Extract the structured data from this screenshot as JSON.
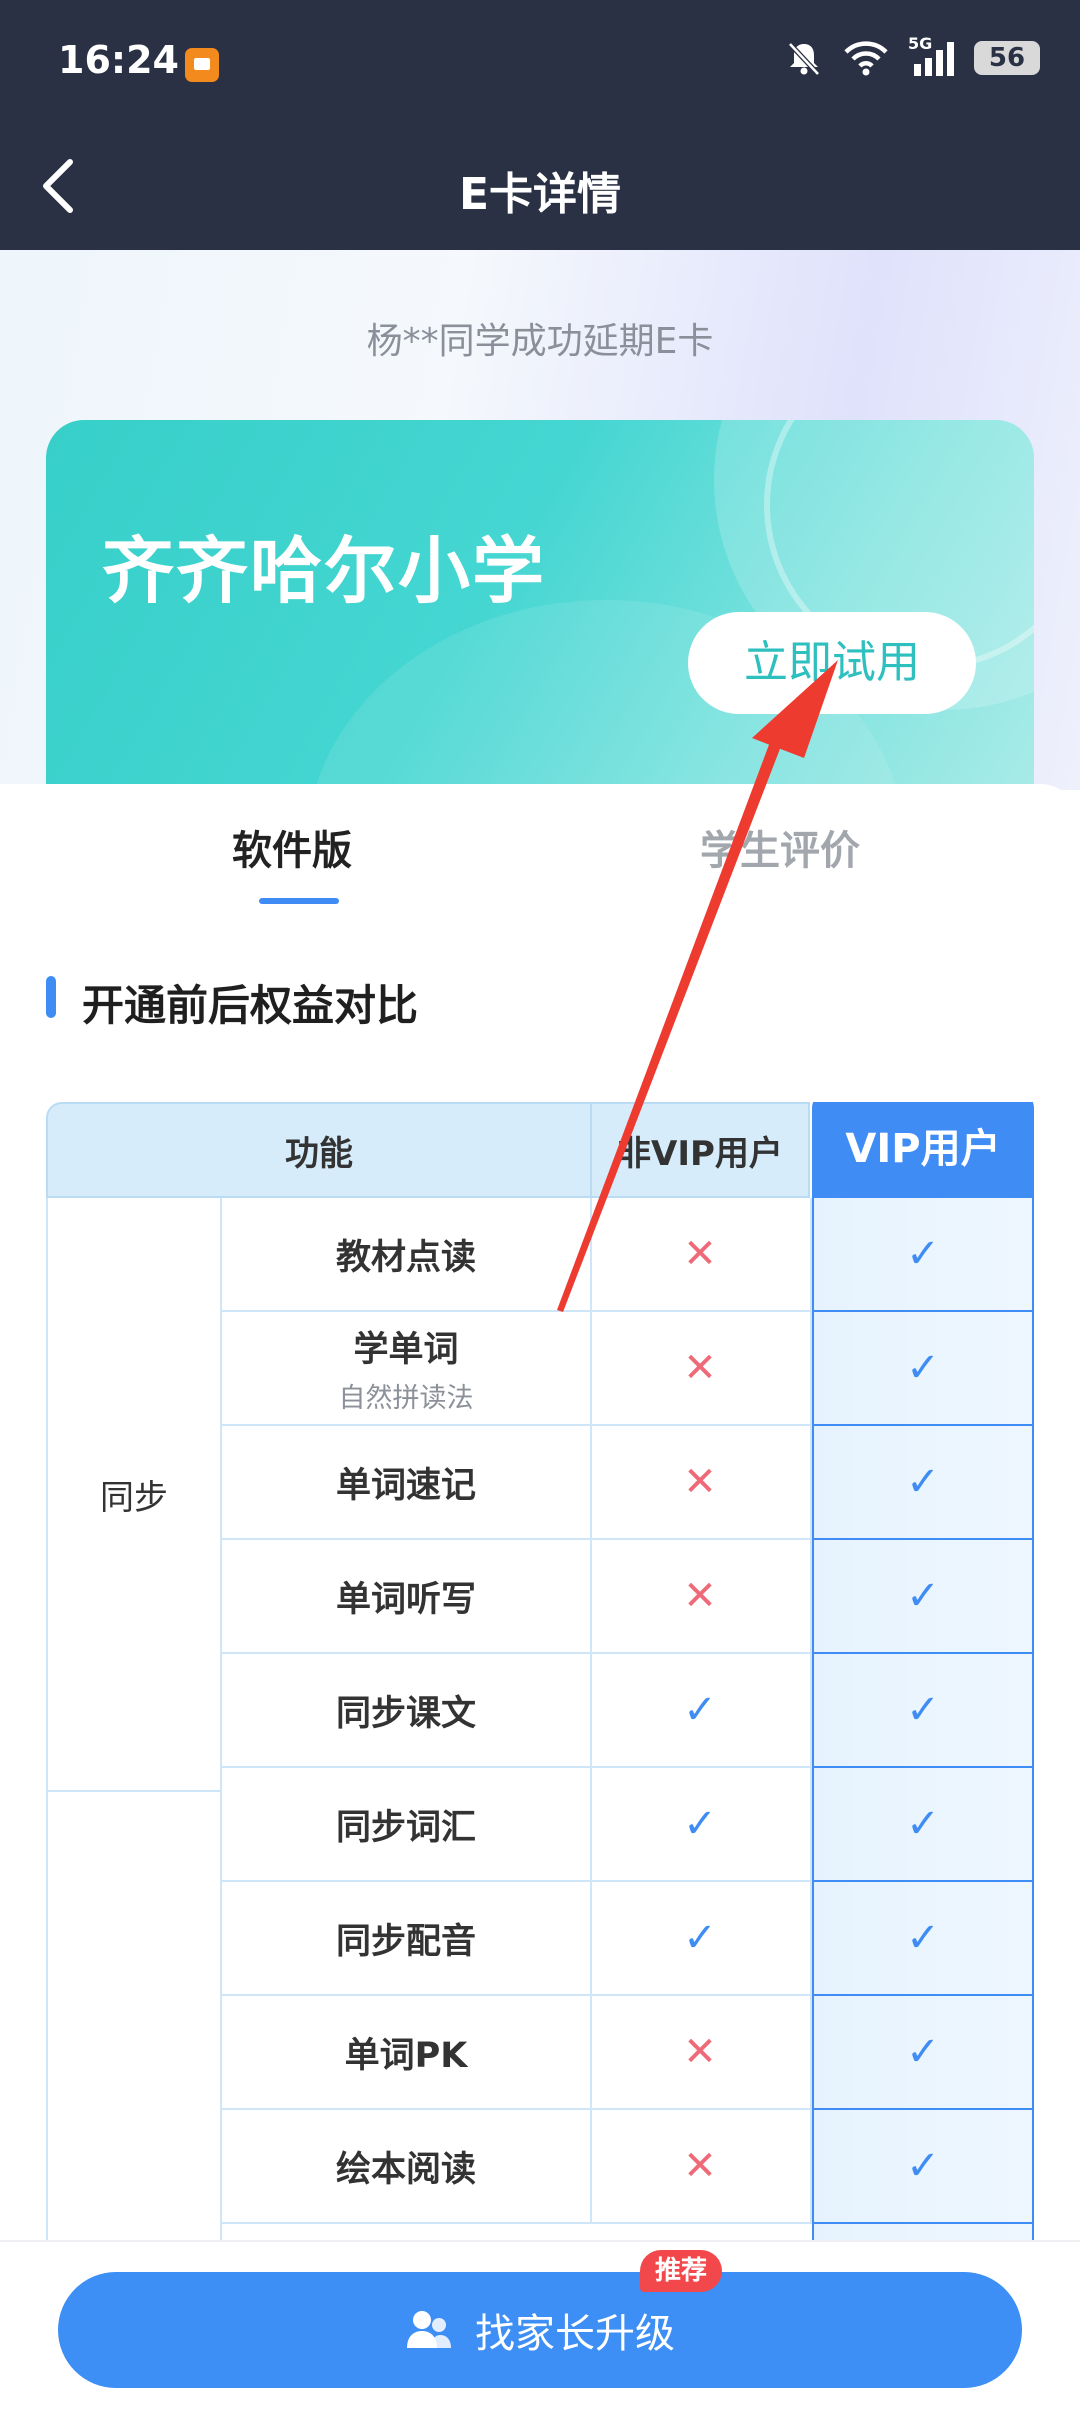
{
  "status_bar": {
    "time": "16:24",
    "battery": "56",
    "network": "5G"
  },
  "header": {
    "title": "E卡详情"
  },
  "notice": "杨**同学成功延期E卡",
  "card": {
    "title": "齐齐哈尔小学",
    "try_button": "立即试用"
  },
  "tabs": [
    {
      "label": "软件版",
      "active": true
    },
    {
      "label": "学生评价",
      "active": false
    }
  ],
  "section_title": "开通前后权益对比",
  "table": {
    "headers": {
      "feature": "功能",
      "non_vip": "非VIP用户",
      "vip": "VIP用户"
    },
    "category": "同步",
    "rows": [
      {
        "name": "教材点读",
        "sub": "",
        "non_vip": "✕",
        "vip": "✓"
      },
      {
        "name": "学单词",
        "sub": "自然拼读法",
        "non_vip": "✕",
        "vip": "✓"
      },
      {
        "name": "单词速记",
        "sub": "",
        "non_vip": "✕",
        "vip": "✓"
      },
      {
        "name": "单词听写",
        "sub": "",
        "non_vip": "✕",
        "vip": "✓"
      },
      {
        "name": "同步课文",
        "sub": "",
        "non_vip": "✓",
        "vip": "✓"
      },
      {
        "name": "同步词汇",
        "sub": "",
        "non_vip": "✓",
        "vip": "✓"
      },
      {
        "name": "同步配音",
        "sub": "",
        "non_vip": "✓",
        "vip": "✓"
      },
      {
        "name": "单词PK",
        "sub": "",
        "non_vip": "✕",
        "vip": "✓"
      },
      {
        "name": "绘本阅读",
        "sub": "",
        "non_vip": "✕",
        "vip": "✓"
      }
    ]
  },
  "bottom": {
    "cta_label": "找家长升级",
    "badge": "推荐"
  },
  "colors": {
    "accent": "#3f8cf4",
    "teal": "#37cfc9",
    "cross": "#ef6a78",
    "badge": "#f2484c",
    "annotation": "#ee3b30"
  }
}
